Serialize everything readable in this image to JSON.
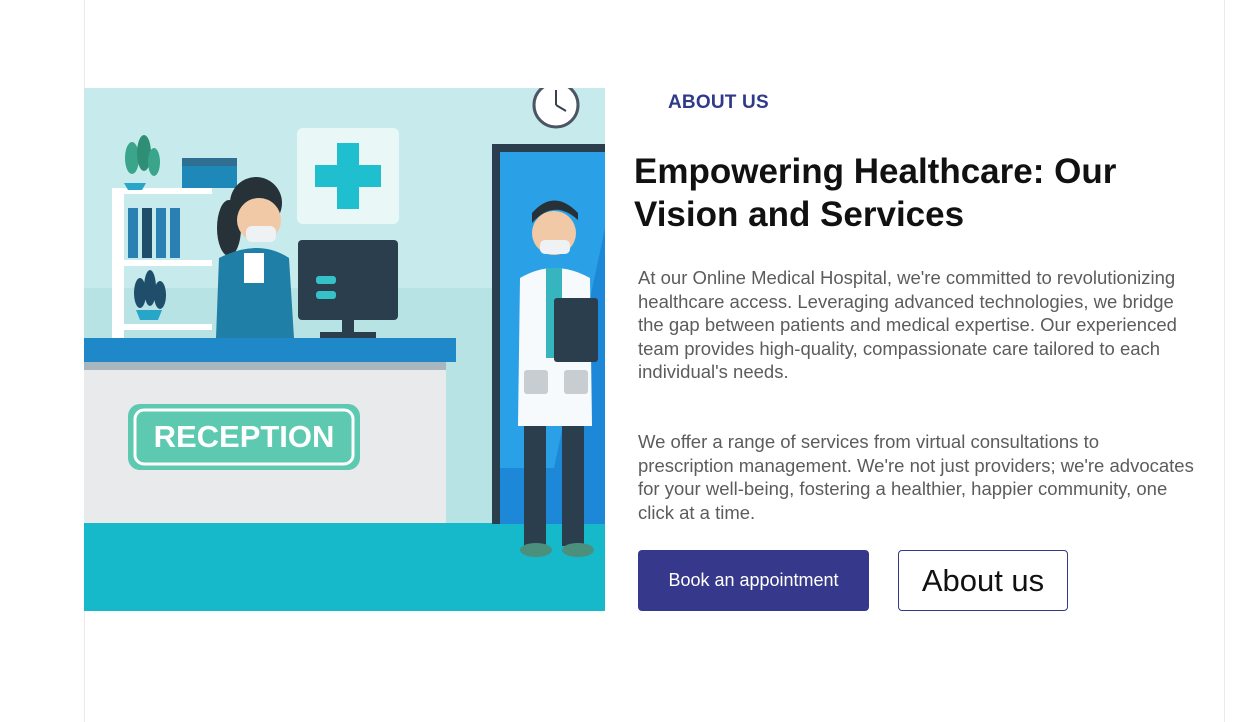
{
  "about": {
    "section_label": "ABOUT US",
    "heading": "Empowering Healthcare: Our Vision and Services",
    "paragraph_1": "At our Online Medical Hospital, we're committed to revolutionizing healthcare access. Leveraging advanced technologies, we bridge the gap between patients and medical expertise. Our experienced team provides high-quality, compassionate care tailored to each individual's needs.",
    "paragraph_2": "We offer a range of services from virtual consultations to prescription management. We're not just providers; we're advocates for your well-being, fostering a healthier, happier community, one click at a time.",
    "primary_button": "Book an appointment",
    "secondary_button": "About us"
  },
  "illustration": {
    "desk_sign": "RECEPTION",
    "icons": [
      "clock-icon",
      "medical-cross-icon",
      "plant-icon",
      "monitor-icon"
    ]
  },
  "colors": {
    "accent": "#36398b",
    "heading": "#111111",
    "body_text": "#5c5c5c",
    "illustration_bg": "#b8e3e5",
    "illustration_floor": "#15b9c9",
    "reception_sign": "#5cc9b0"
  }
}
